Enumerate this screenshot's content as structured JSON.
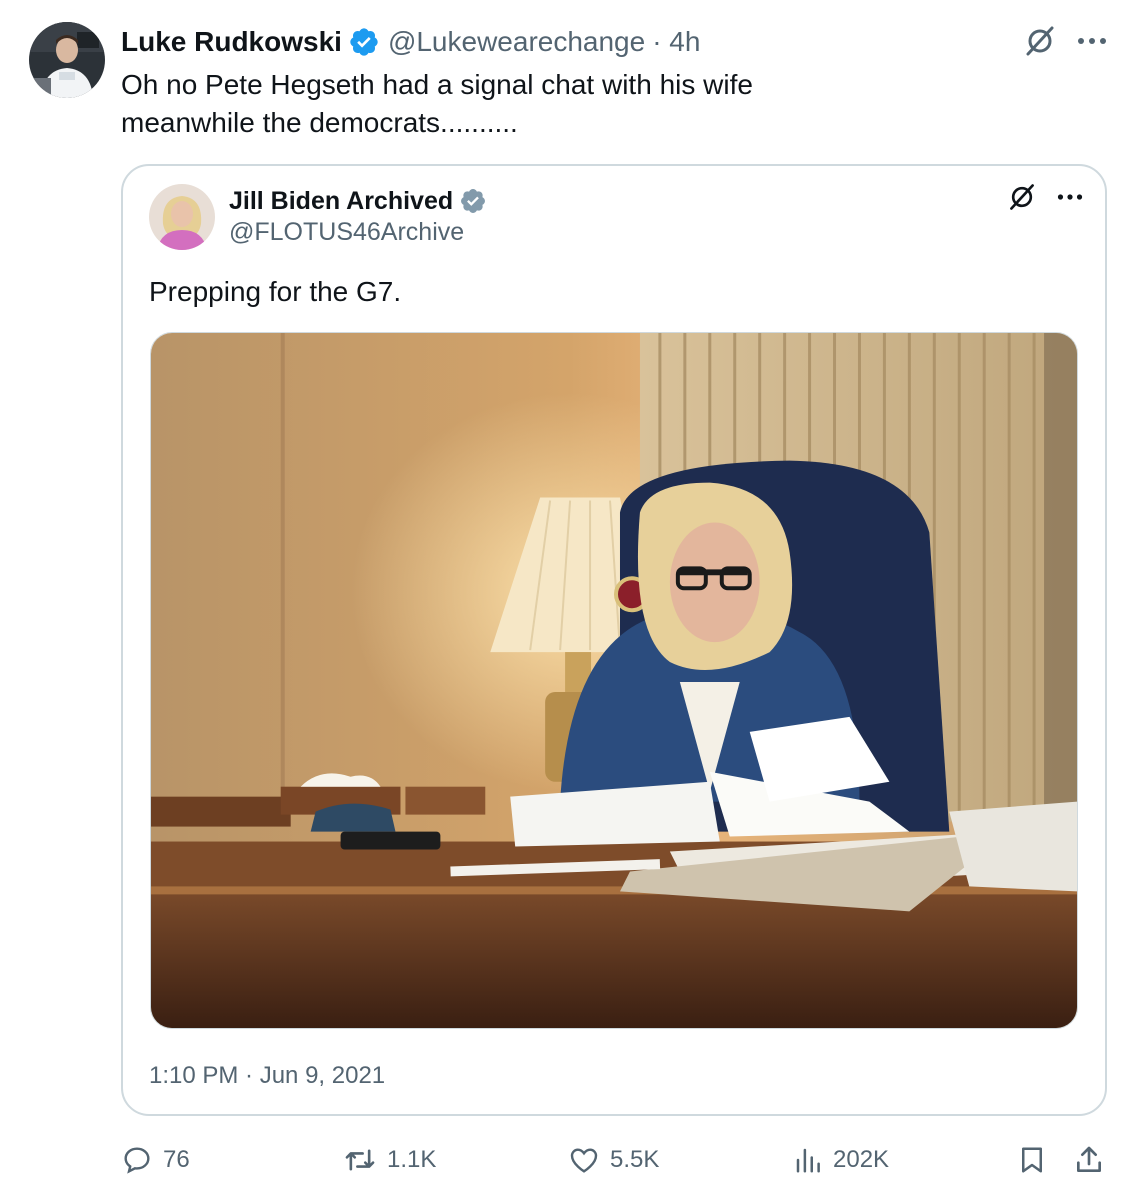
{
  "tweet": {
    "author": {
      "name": "Luke Rudkowski",
      "handle": "@Lukewearechange",
      "age": "· 4h"
    },
    "text_line1": "Oh no Pete Hegseth had a signal chat with his wife",
    "text_line2": "meanwhile the democrats..........",
    "icons": {
      "grok": "grok-icon",
      "more": "more-icon"
    }
  },
  "quote": {
    "author": {
      "name": "Jill Biden Archived",
      "handle": "@FLOTUS46Archive"
    },
    "text": "Prepping for the G7.",
    "timestamp": "1:10 PM · Jun 9, 2021"
  },
  "actions": {
    "replies": "76",
    "reposts": "1.1K",
    "likes": "5.5K",
    "views": "202K"
  },
  "colors": {
    "verified": "#1d9bf0",
    "verified_gray": "#829aab",
    "text_primary": "#0f1419",
    "text_secondary": "#536471",
    "border": "#cfd9de"
  }
}
